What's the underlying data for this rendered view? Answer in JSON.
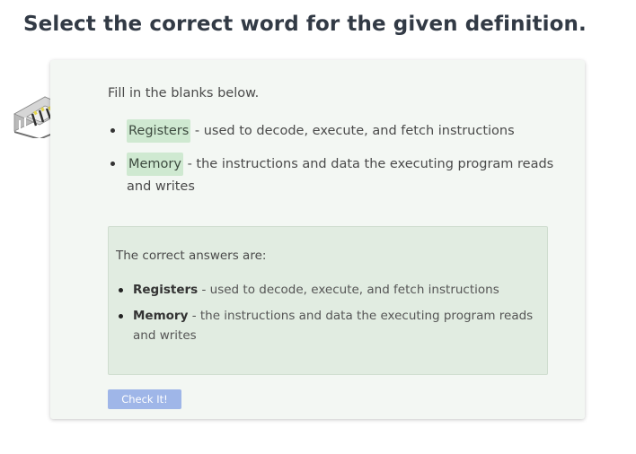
{
  "heading": "Select the correct word for the given definition.",
  "activity": {
    "instructions": "Fill in the blanks below.",
    "blanks": [
      {
        "answer": "Registers",
        "definition": "- used to decode, execute, and fetch instructions"
      },
      {
        "answer": "Memory",
        "definition": "- the instructions and data the executing program reads and writes"
      }
    ],
    "answers_box": {
      "title": "The correct answers are:",
      "items": [
        {
          "term": "Registers",
          "definition": "- used to decode, execute, and fetch instructions"
        },
        {
          "term": "Memory",
          "definition": "- the instructions and data the executing program reads and writes"
        }
      ]
    },
    "check_button_label": "Check It!",
    "icon": "cpu-chip-icon"
  },
  "colors": {
    "card_background": "#f3f7f3",
    "answer_chip": "#cfe9d1",
    "answers_box_background": "#e1ece1",
    "check_button": "#9fb6e8",
    "heading_text": "#323a45"
  }
}
